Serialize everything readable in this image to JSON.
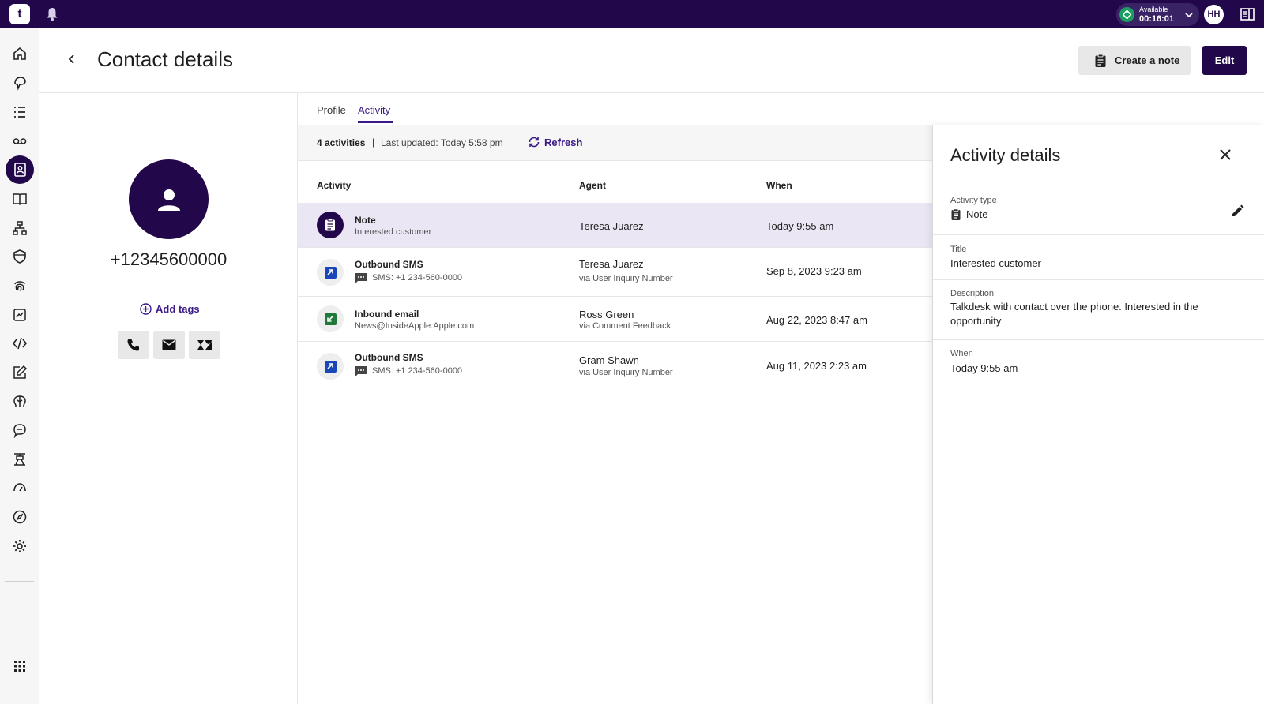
{
  "topbar": {
    "logo_text": "t",
    "status": {
      "label": "Available",
      "timer": "00:16:01",
      "color": "#1c9e63"
    },
    "user_initials": "HH"
  },
  "sidebar": {
    "items": [
      {
        "icon": "home-icon"
      },
      {
        "icon": "conversations-icon"
      },
      {
        "icon": "list-icon"
      },
      {
        "icon": "voicemail-icon"
      },
      {
        "icon": "contacts-icon",
        "active": true
      },
      {
        "icon": "knowledge-book-icon"
      },
      {
        "icon": "flow-icon"
      },
      {
        "icon": "shield-icon"
      },
      {
        "icon": "fingerprint-icon"
      },
      {
        "icon": "analytics-icon"
      },
      {
        "icon": "code-icon"
      },
      {
        "icon": "edit-icon"
      },
      {
        "icon": "ai-brain-icon"
      },
      {
        "icon": "chat-icon"
      },
      {
        "icon": "workforce-icon"
      },
      {
        "icon": "speedometer-icon"
      },
      {
        "icon": "explore-icon"
      },
      {
        "icon": "settings-icon"
      }
    ],
    "apps_icon": "apps-grid-icon"
  },
  "header": {
    "title": "Contact details",
    "create_note_label": "Create a note",
    "edit_label": "Edit"
  },
  "contact": {
    "phone": "+12345600000",
    "add_tags_label": "Add tags",
    "actions": [
      "phone-icon",
      "email-icon",
      "zendesk-icon"
    ]
  },
  "tabs": {
    "profile": "Profile",
    "activity": "Activity",
    "active": "activity"
  },
  "summary": {
    "count": "4 activities",
    "separator": "|",
    "last_updated": "Last updated: Today 5:58 pm",
    "refresh_label": "Refresh"
  },
  "table": {
    "headers": {
      "activity": "Activity",
      "agent": "Agent",
      "when": "When"
    },
    "rows": [
      {
        "type": "note",
        "title": "Note",
        "subtitle": "Interested customer",
        "agent": "Teresa Juarez",
        "via": "",
        "when": "Today 9:55 am",
        "selected": true
      },
      {
        "type": "outbound-sms",
        "title": "Outbound SMS",
        "subtitle": "SMS: +1 234-560-0000",
        "agent": "Teresa Juarez",
        "via": "via User Inquiry Number",
        "when": "Sep 8, 2023 9:23 am"
      },
      {
        "type": "inbound-email",
        "title": "Inbound email",
        "subtitle": "News@InsideApple.Apple.com",
        "agent": "Ross Green",
        "via": "via Comment Feedback",
        "when": "Aug 22, 2023 8:47 am"
      },
      {
        "type": "outbound-sms",
        "title": "Outbound SMS",
        "subtitle": "SMS: +1 234-560-0000",
        "agent": "Gram Shawn",
        "via": "via User Inquiry Number",
        "when": "Aug 11, 2023 2:23 am"
      }
    ]
  },
  "details": {
    "title": "Activity details",
    "activity_type_label": "Activity type",
    "activity_type_value": "Note",
    "title_label": "Title",
    "title_value": "Interested customer",
    "description_label": "Description",
    "description_value": "Talkdesk with contact over the phone. Interested in the opportunity",
    "when_label": "When",
    "when_value": "Today 9:55 am"
  },
  "colors": {
    "brand": "#22084a",
    "accent": "#3b1a87",
    "selected_row": "#eae6f4",
    "outbound_sms": "#1a47b8",
    "inbound_email": "#1f7a3a"
  }
}
